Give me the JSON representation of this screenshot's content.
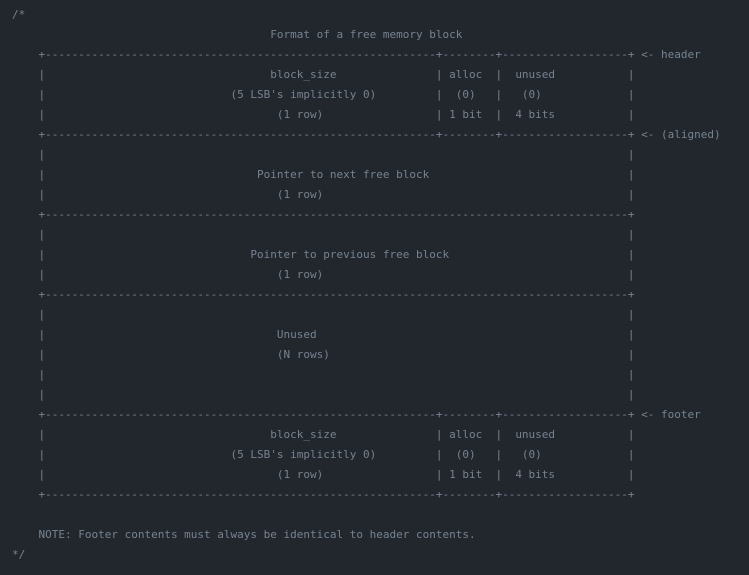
{
  "theme": {
    "background": "#22272e",
    "comment_color": "#768390"
  },
  "code": {
    "lines": [
      "/*",
      "                                       Format of a free memory block",
      "    +-----------------------------------------------------------+--------+-------------------+ <- header",
      "    |                                  block_size               | alloc  |  unused           |",
      "    |                            (5 LSB's implicitly 0)         |  (0)   |   (0)             |",
      "    |                                   (1 row)                 | 1 bit  |  4 bits           |",
      "    +-----------------------------------------------------------+--------+-------------------+ <- (aligned)",
      "    |                                                                                        |",
      "    |                                Pointer to next free block                              |",
      "    |                                   (1 row)                                              |",
      "    +----------------------------------------------------------------------------------------+",
      "    |                                                                                        |",
      "    |                               Pointer to previous free block                           |",
      "    |                                   (1 row)                                              |",
      "    +----------------------------------------------------------------------------------------+",
      "    |                                                                                        |",
      "    |                                   Unused                                               |",
      "    |                                   (N rows)                                             |",
      "    |                                                                                        |",
      "    |                                                                                        |",
      "    +-----------------------------------------------------------+--------+-------------------+ <- footer",
      "    |                                  block_size               | alloc  |  unused           |",
      "    |                            (5 LSB's implicitly 0)         |  (0)   |   (0)             |",
      "    |                                   (1 row)                 | 1 bit  |  4 bits           |",
      "    +-----------------------------------------------------------+--------+-------------------+",
      "",
      "    NOTE: Footer contents must always be identical to header contents.",
      "*/"
    ]
  }
}
